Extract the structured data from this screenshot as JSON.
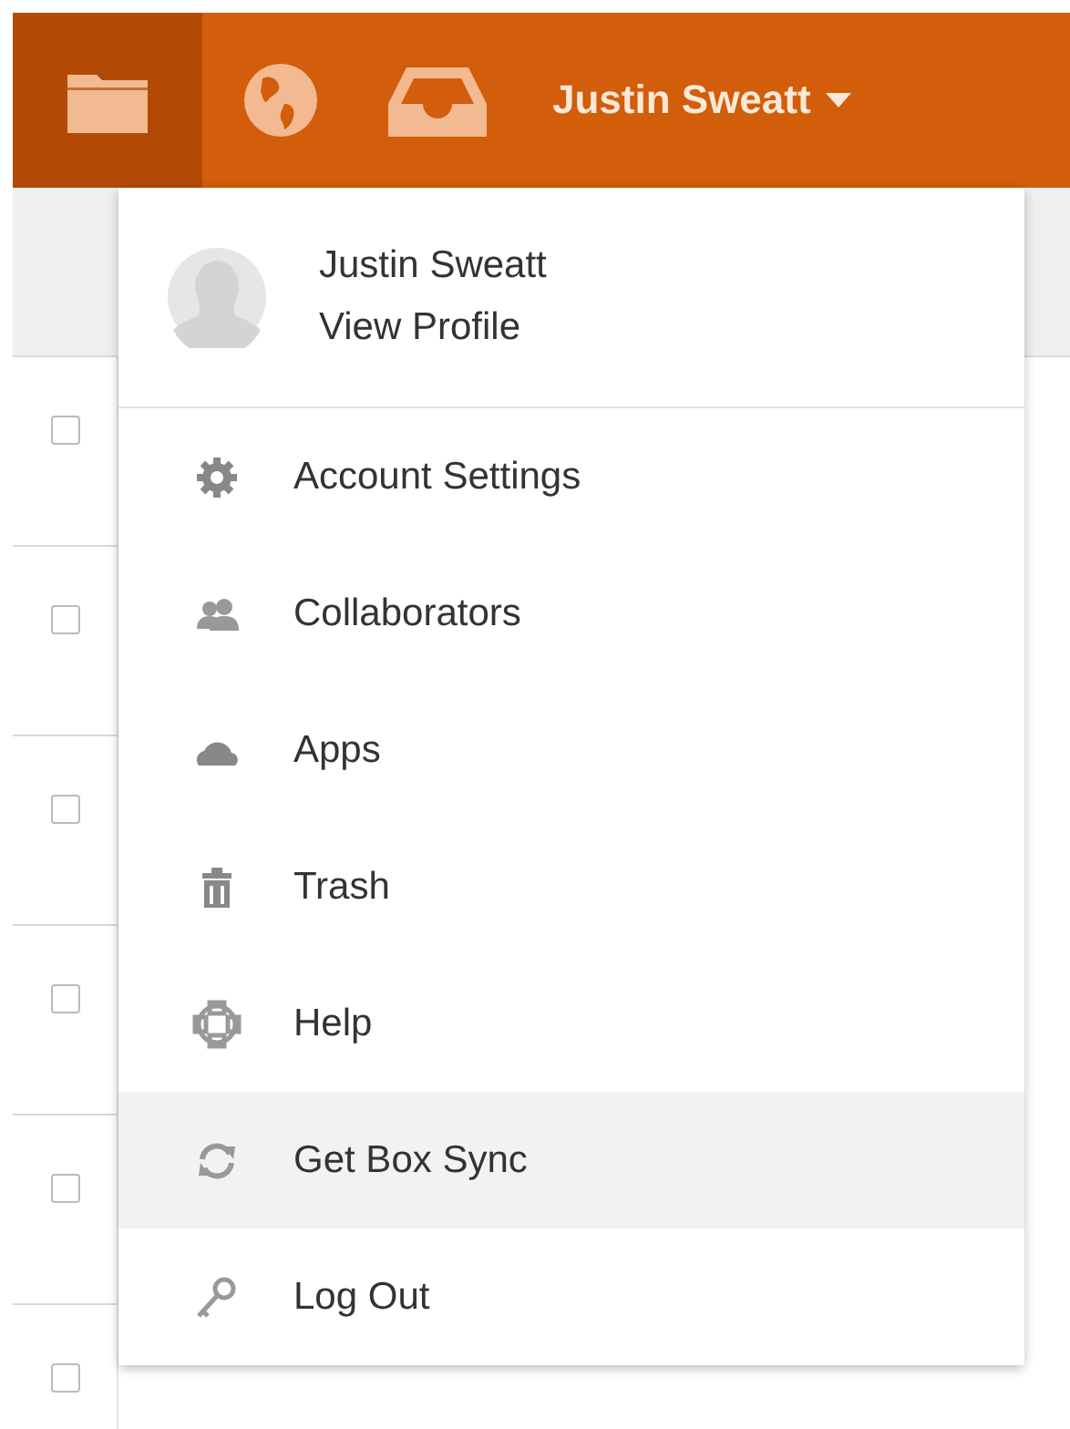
{
  "top_bar": {
    "nav_icons": [
      {
        "kind": "folder",
        "selected": true
      },
      {
        "kind": "globe",
        "selected": false
      },
      {
        "kind": "inbox",
        "selected": false
      }
    ],
    "user_menu": {
      "label": "Justin Sweatt"
    }
  },
  "file_rows": [
    {
      "checked": false
    },
    {
      "checked": false
    },
    {
      "checked": false
    },
    {
      "checked": false
    },
    {
      "checked": false
    },
    {
      "checked": false
    }
  ],
  "account_menu": {
    "profile": {
      "name": "Justin Sweatt",
      "link": "View Profile"
    },
    "items": [
      {
        "kind": "settings",
        "label": "Account Settings",
        "selected": false
      },
      {
        "kind": "collaborators",
        "label": "Collaborators",
        "selected": false
      },
      {
        "kind": "apps",
        "label": "Apps",
        "selected": false
      },
      {
        "kind": "trash",
        "label": "Trash",
        "selected": false
      },
      {
        "kind": "help",
        "label": "Help",
        "selected": false
      },
      {
        "kind": "sync",
        "label": "Get Box Sync",
        "selected": true
      },
      {
        "kind": "logout",
        "label": "Log Out",
        "selected": false
      }
    ]
  }
}
